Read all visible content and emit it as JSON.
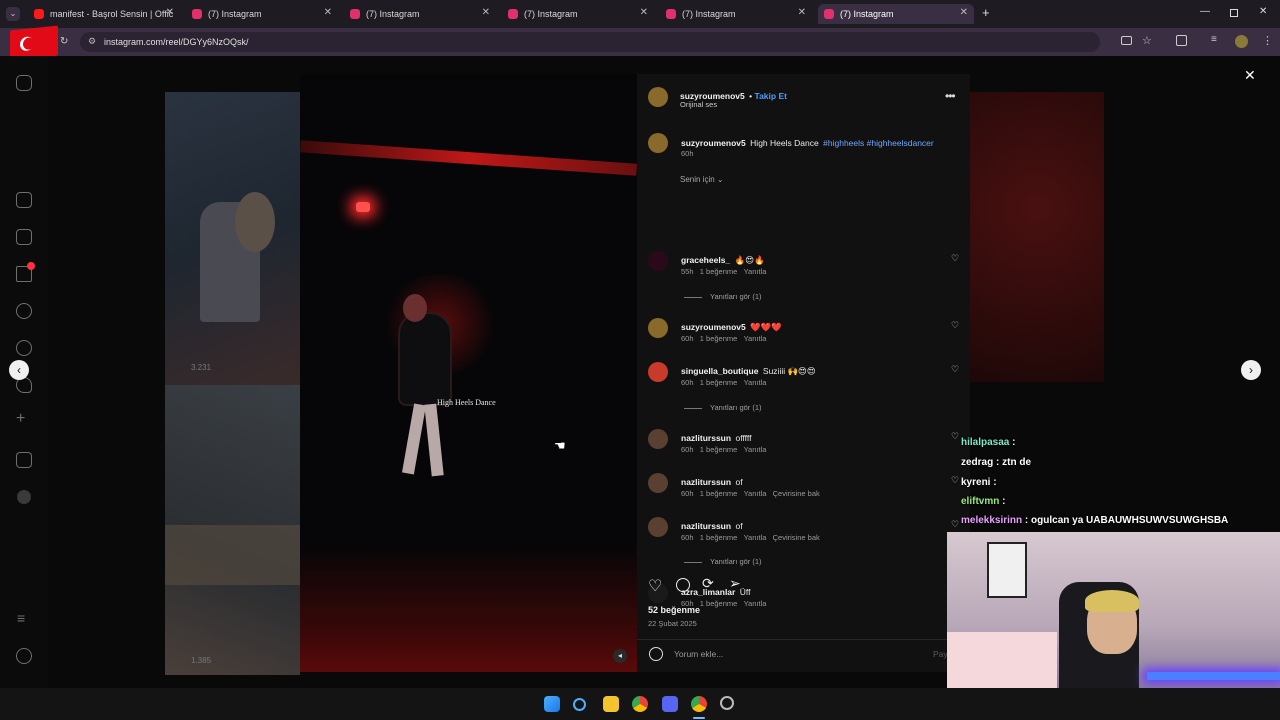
{
  "browser": {
    "tabs": [
      {
        "title": "manifest - Başrol Sensin | Offic",
        "icon": "youtube-icon",
        "color": "#ff1a1a"
      },
      {
        "title": "(7) Instagram",
        "icon": "instagram-icon",
        "color": "#e1306c"
      },
      {
        "title": "(7) Instagram",
        "icon": "instagram-icon",
        "color": "#e1306c"
      },
      {
        "title": "(7) Instagram",
        "icon": "instagram-icon",
        "color": "#e1306c"
      },
      {
        "title": "(7) Instagram",
        "icon": "instagram-icon",
        "color": "#e1306c"
      },
      {
        "title": "(7) Instagram",
        "icon": "instagram-icon",
        "color": "#e1306c"
      }
    ],
    "new_tab": "+",
    "url": "instagram.com/reel/DGYy6NzOQsk/"
  },
  "background": {
    "view_count_1": "3.231",
    "view_count_2": "1.385"
  },
  "video": {
    "caption_overlay": "High Heels Dance"
  },
  "post": {
    "author": "suzyroumenov5",
    "follow_label": "Takip Et",
    "audio": "Orijinal ses",
    "caption_text": "High Heels Dance",
    "caption_tags": "#highheels #highheelsdancer",
    "caption_time": "60h",
    "sort_label": "Senin için",
    "likes": "52 beğenme",
    "date": "22 Şubat 2025",
    "comment_placeholder": "Yorum ekle...",
    "post_button": "Pay"
  },
  "comments": [
    {
      "user": "graceheels_",
      "text": "🔥😍🔥",
      "time": "55h",
      "likes": "1 beğenme",
      "reply": "Yanıtla",
      "see_replies": "Yanıtları gör (1)",
      "avatar_color": "#2a0a1a"
    },
    {
      "user": "suzyroumenov5",
      "text": "❤️❤️❤️",
      "time": "60h",
      "likes": "1 beğenme",
      "reply": "Yanıtla",
      "avatar_color": "#8a6a2a"
    },
    {
      "user": "singuella_boutique",
      "text": "Suziiii 🙌😍😍",
      "time": "60h",
      "likes": "1 beğenme",
      "reply": "Yanıtla",
      "see_replies": "Yanıtları gör (1)",
      "avatar_color": "#c83a2a"
    },
    {
      "user": "nazliturssun",
      "text": "offfff",
      "time": "60h",
      "likes": "1 beğenme",
      "reply": "Yanıtla",
      "avatar_color": "#5a4030"
    },
    {
      "user": "nazliturssun",
      "text": "of",
      "time": "60h",
      "likes": "1 beğenme",
      "reply": "Yanıtla",
      "translate": "Çevirisine bak",
      "avatar_color": "#5a4030"
    },
    {
      "user": "nazliturssun",
      "text": "of",
      "time": "60h",
      "likes": "1 beğenme",
      "reply": "Yanıtla",
      "translate": "Çevirisine bak",
      "see_replies": "Yanıtları gör (1)",
      "avatar_color": "#5a4030"
    },
    {
      "user": "azra_limanlar",
      "text": "Üff",
      "time": "60h",
      "likes": "1 beğenme",
      "reply": "Yanıtla",
      "avatar_color": "#1a1a1a"
    }
  ],
  "chat": [
    {
      "user": "hilalpasaa",
      "msg": "",
      "color": "#7ee8c8"
    },
    {
      "user": "zedrag",
      "msg": "ztn de",
      "color": "#ffffff"
    },
    {
      "user": "kyreni",
      "msg": "",
      "color": "#ffffff"
    },
    {
      "user": "eliftvmn",
      "msg": "",
      "color": "#9be87e"
    },
    {
      "user": "melekksirinn",
      "msg": "ogulcan ya UABAUWHSUWVSUWGHSBA",
      "color": "#e8a0ff"
    }
  ]
}
